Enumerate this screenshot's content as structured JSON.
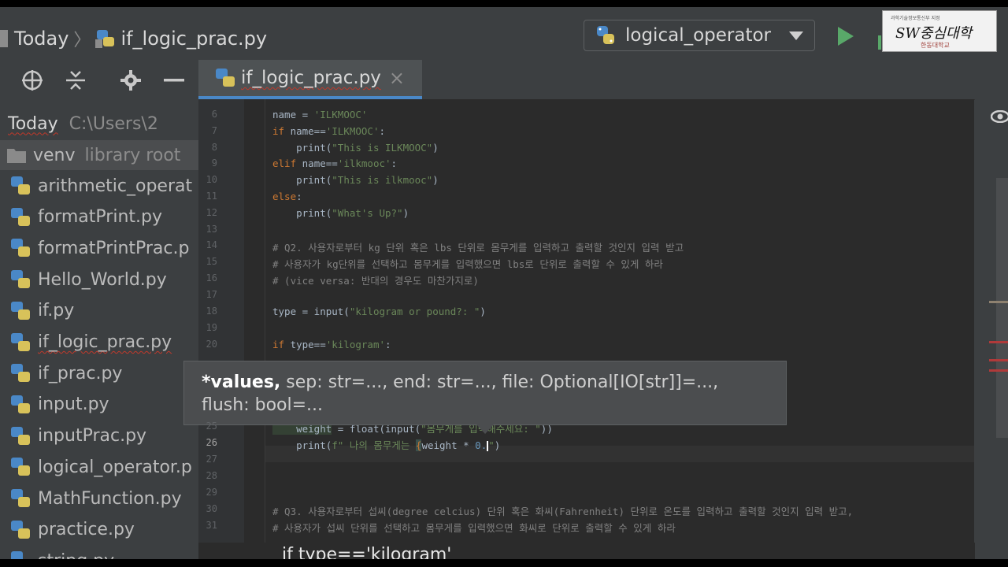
{
  "breadcrumb": {
    "project": "Today",
    "file": "if_logic_prac.py"
  },
  "run_config": {
    "name": "logical_operator"
  },
  "logo": {
    "top_text": "과학기술정보통신부 지정",
    "main_text": "SW중심대학",
    "sub_text": "한동대학교"
  },
  "project_tree": {
    "root_name": "Today",
    "root_path": "C:\\Users\\2",
    "venv": "venv",
    "venv_hint": "library root",
    "files": [
      "arithmetic_operat",
      "formatPrint.py",
      "formatPrintPrac.p",
      "Hello_World.py",
      "if.py",
      "if_logic_prac.py",
      "if_prac.py",
      "input.py",
      "inputPrac.py",
      "logical_operator.p",
      "MathFunction.py",
      "practice.py",
      "string.py"
    ]
  },
  "editor": {
    "tab_label": "if_logic_prac.py",
    "close_glyph": "×",
    "lines": [
      {
        "n": "6"
      },
      {
        "n": "7"
      },
      {
        "n": "8"
      },
      {
        "n": "9"
      },
      {
        "n": "10"
      },
      {
        "n": "11"
      },
      {
        "n": "12"
      },
      {
        "n": "13"
      },
      {
        "n": "14"
      },
      {
        "n": "15"
      },
      {
        "n": "16"
      },
      {
        "n": "17"
      },
      {
        "n": "18"
      },
      {
        "n": "19"
      },
      {
        "n": "20"
      },
      {
        "n": "25"
      },
      {
        "n": "26"
      },
      {
        "n": "27"
      },
      {
        "n": "28"
      },
      {
        "n": "29"
      },
      {
        "n": "30"
      },
      {
        "n": "31"
      }
    ],
    "code": {
      "l6a": "name = ",
      "l6b": "'ILKMOOC'",
      "l7a": "if ",
      "l7b": "name==",
      "l7c": "'ILKMOOC'",
      "l7d": ":",
      "l8a": "    print(",
      "l8b": "\"This is ILKMOOC\"",
      "l8c": ")",
      "l9a": "elif ",
      "l9b": "name==",
      "l9c": "'ilkmooc'",
      "l9d": ":",
      "l10a": "    print(",
      "l10b": "\"This is ilkmooc\"",
      "l10c": ")",
      "l11a": "else",
      "l11b": ":",
      "l12a": "    print(",
      "l12b": "\"What's Up?\"",
      "l12c": ")",
      "l14": "# Q2. 사용자로부터 kg 단위 혹은 lbs 단위로 몸무게를 입력하고 출력할 것인지 입력 받고",
      "l15": "# 사용자가 kg단위를 선택하고 몸무게를 입력했으면 lbs로 단위로 출력할 수 있게 하라",
      "l16": "# (vice versa: 반대의 경우도 마찬가지로)",
      "l18a": "type = input(",
      "l18b": "\"kilogram or pound?: \"",
      "l18c": ")",
      "l20a": "if ",
      "l20b": "type==",
      "l20c": "'kilogram'",
      "l20d": ":",
      "l25a": "    weight",
      "l25b": " = float(input(",
      "l25c": "\"몸무게를 입력해주세요: \"",
      "l25d": "))",
      "l26a": "    print(",
      "l26b": "f\" 나의 몸무게는 ",
      "l26c": "{",
      "l26d": "weight * ",
      "l26e": "0.",
      "l26f": "\"",
      "l26g": ")",
      "l30": "# Q3. 사용자로부터 섭씨(degree celcius) 단위 혹은 화씨(Fahrenheit) 단위로 온도를 입력하고 출력할 것인지 입력 받고,",
      "l31": "# 사용자가 섭씨 단위를 선택하고 몸무게를 입력했으면 화씨로 단위로 출력할 수 있게 하라"
    }
  },
  "tooltip": {
    "param_bold": "*values,",
    "rest": " sep: str=..., end: str=..., file: Optional[IO[str]]=..., flush: bool=..."
  },
  "bottom_context": "if type=='kilogram'"
}
